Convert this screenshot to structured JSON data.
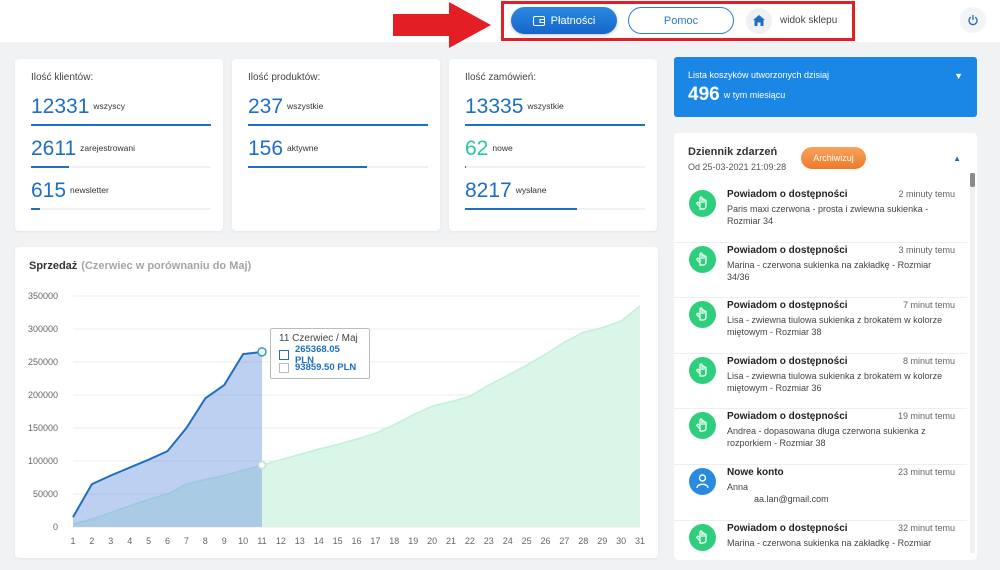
{
  "topbar": {
    "payments_label": "Płatności",
    "help_label": "Pomoc",
    "shop_view_label": "widok sklepu"
  },
  "colors": {
    "accent": "#1d6fc2",
    "cart_banner": "#1a86e6",
    "archive": "#f08c3c",
    "highlight": "#e31e24",
    "log_green": "#2ecf7c"
  },
  "stats": [
    {
      "title": "Ilość klientów:",
      "rows": [
        {
          "value": "12331",
          "label": "wszyscy",
          "fill": 1.0
        },
        {
          "value": "2611",
          "label": "zarejestrowani",
          "fill": 0.21
        },
        {
          "value": "615",
          "label": "newsletter",
          "fill": 0.05
        }
      ]
    },
    {
      "title": "Ilość produktów:",
      "rows": [
        {
          "value": "237",
          "label": "wszystkie",
          "fill": 1.0
        },
        {
          "value": "156",
          "label": "aktywne",
          "fill": 0.66
        }
      ]
    },
    {
      "title": "Ilość zamówień:",
      "rows": [
        {
          "value": "13335",
          "label": "wszystkie",
          "fill": 1.0
        },
        {
          "value": "62",
          "label": "nowe",
          "fill": 0.005
        },
        {
          "value": "8217",
          "label": "wysłane",
          "fill": 0.62
        }
      ]
    }
  ],
  "cart": {
    "title": "Lista koszyków utworzonych dzisiaj",
    "count": "496",
    "subtitle": "w tym miesiącu"
  },
  "log": {
    "title": "Dziennik zdarzeń",
    "date": "Od 25-03-2021 21:09:28",
    "archive_label": "Archiwizuj",
    "items": [
      {
        "icon": "hand-icon",
        "title": "Powiadom o dostępności",
        "time": "2 minuty temu",
        "line1": "Paris maxi czerwona - prosta i zwiewna sukienka - Rozmiar 34",
        "line2": ""
      },
      {
        "icon": "hand-icon",
        "title": "Powiadom o dostępności",
        "time": "3 minuty temu",
        "line1": "Marina - czerwona sukienka na zakładkę - Rozmiar 34/36",
        "line2": ""
      },
      {
        "icon": "hand-icon",
        "title": "Powiadom o dostępności",
        "time": "7 minut temu",
        "line1": "Lisa - zwiewna tiulowa sukienka z brokatem w kolorze miętowym - Rozmiar 38",
        "line2": ""
      },
      {
        "icon": "hand-icon",
        "title": "Powiadom o dostępności",
        "time": "8 minut temu",
        "line1": "Lisa - zwiewna tiulowa sukienka z brokatem w kolorze miętowym - Rozmiar 36",
        "line2": ""
      },
      {
        "icon": "hand-icon",
        "title": "Powiadom o dostępności",
        "time": "19 minut temu",
        "line1": "Andrea - dopasowana długa czerwona sukienka z rozporkiem - Rozmiar 38",
        "line2": ""
      },
      {
        "icon": "user-icon",
        "title": "Nowe konto",
        "time": "23 minut temu",
        "line1": "Anna",
        "line2": "aa.lan@gmail.com"
      },
      {
        "icon": "hand-icon",
        "title": "Powiadom o dostępności",
        "time": "32 minut temu",
        "line1": "Marina - czerwona sukienka na zakładkę - Rozmiar",
        "line2": ""
      }
    ]
  },
  "sales": {
    "title": "Sprzedaż",
    "subtitle": "(Czerwiec w porównaniu do Maj)",
    "tooltip": {
      "title": "11 Czerwiec / Maj",
      "current": "265368.05 PLN",
      "previous": "93859.50 PLN"
    }
  },
  "chart_data": {
    "type": "area",
    "title": "Sprzedaż",
    "subtitle": "(Czerwiec w porównaniu do Maj)",
    "ylim": [
      0,
      350000
    ],
    "yticks": [
      "0",
      "50000",
      "100000",
      "150000",
      "200000",
      "250000",
      "300000",
      "350000"
    ],
    "categories": [
      1,
      2,
      3,
      4,
      5,
      6,
      7,
      8,
      9,
      10,
      11,
      12,
      13,
      14,
      15,
      16,
      17,
      18,
      19,
      20,
      21,
      22,
      23,
      24,
      25,
      26,
      27,
      28,
      29,
      30,
      31
    ],
    "series": [
      {
        "values": [
          15000,
          65000,
          78000,
          90000,
          102000,
          115000,
          150000,
          195000,
          215000,
          262000,
          265368.05
        ]
      },
      {
        "values": [
          5000,
          12000,
          22000,
          32000,
          42000,
          50000,
          65000,
          72000,
          78000,
          86000,
          93859.5,
          102000,
          110000,
          118000,
          125000,
          133000,
          142000,
          155000,
          170000,
          183000,
          190000,
          198000,
          215000,
          230000,
          245000,
          262000,
          280000,
          295000,
          302000,
          312000,
          335000
        ]
      }
    ]
  }
}
